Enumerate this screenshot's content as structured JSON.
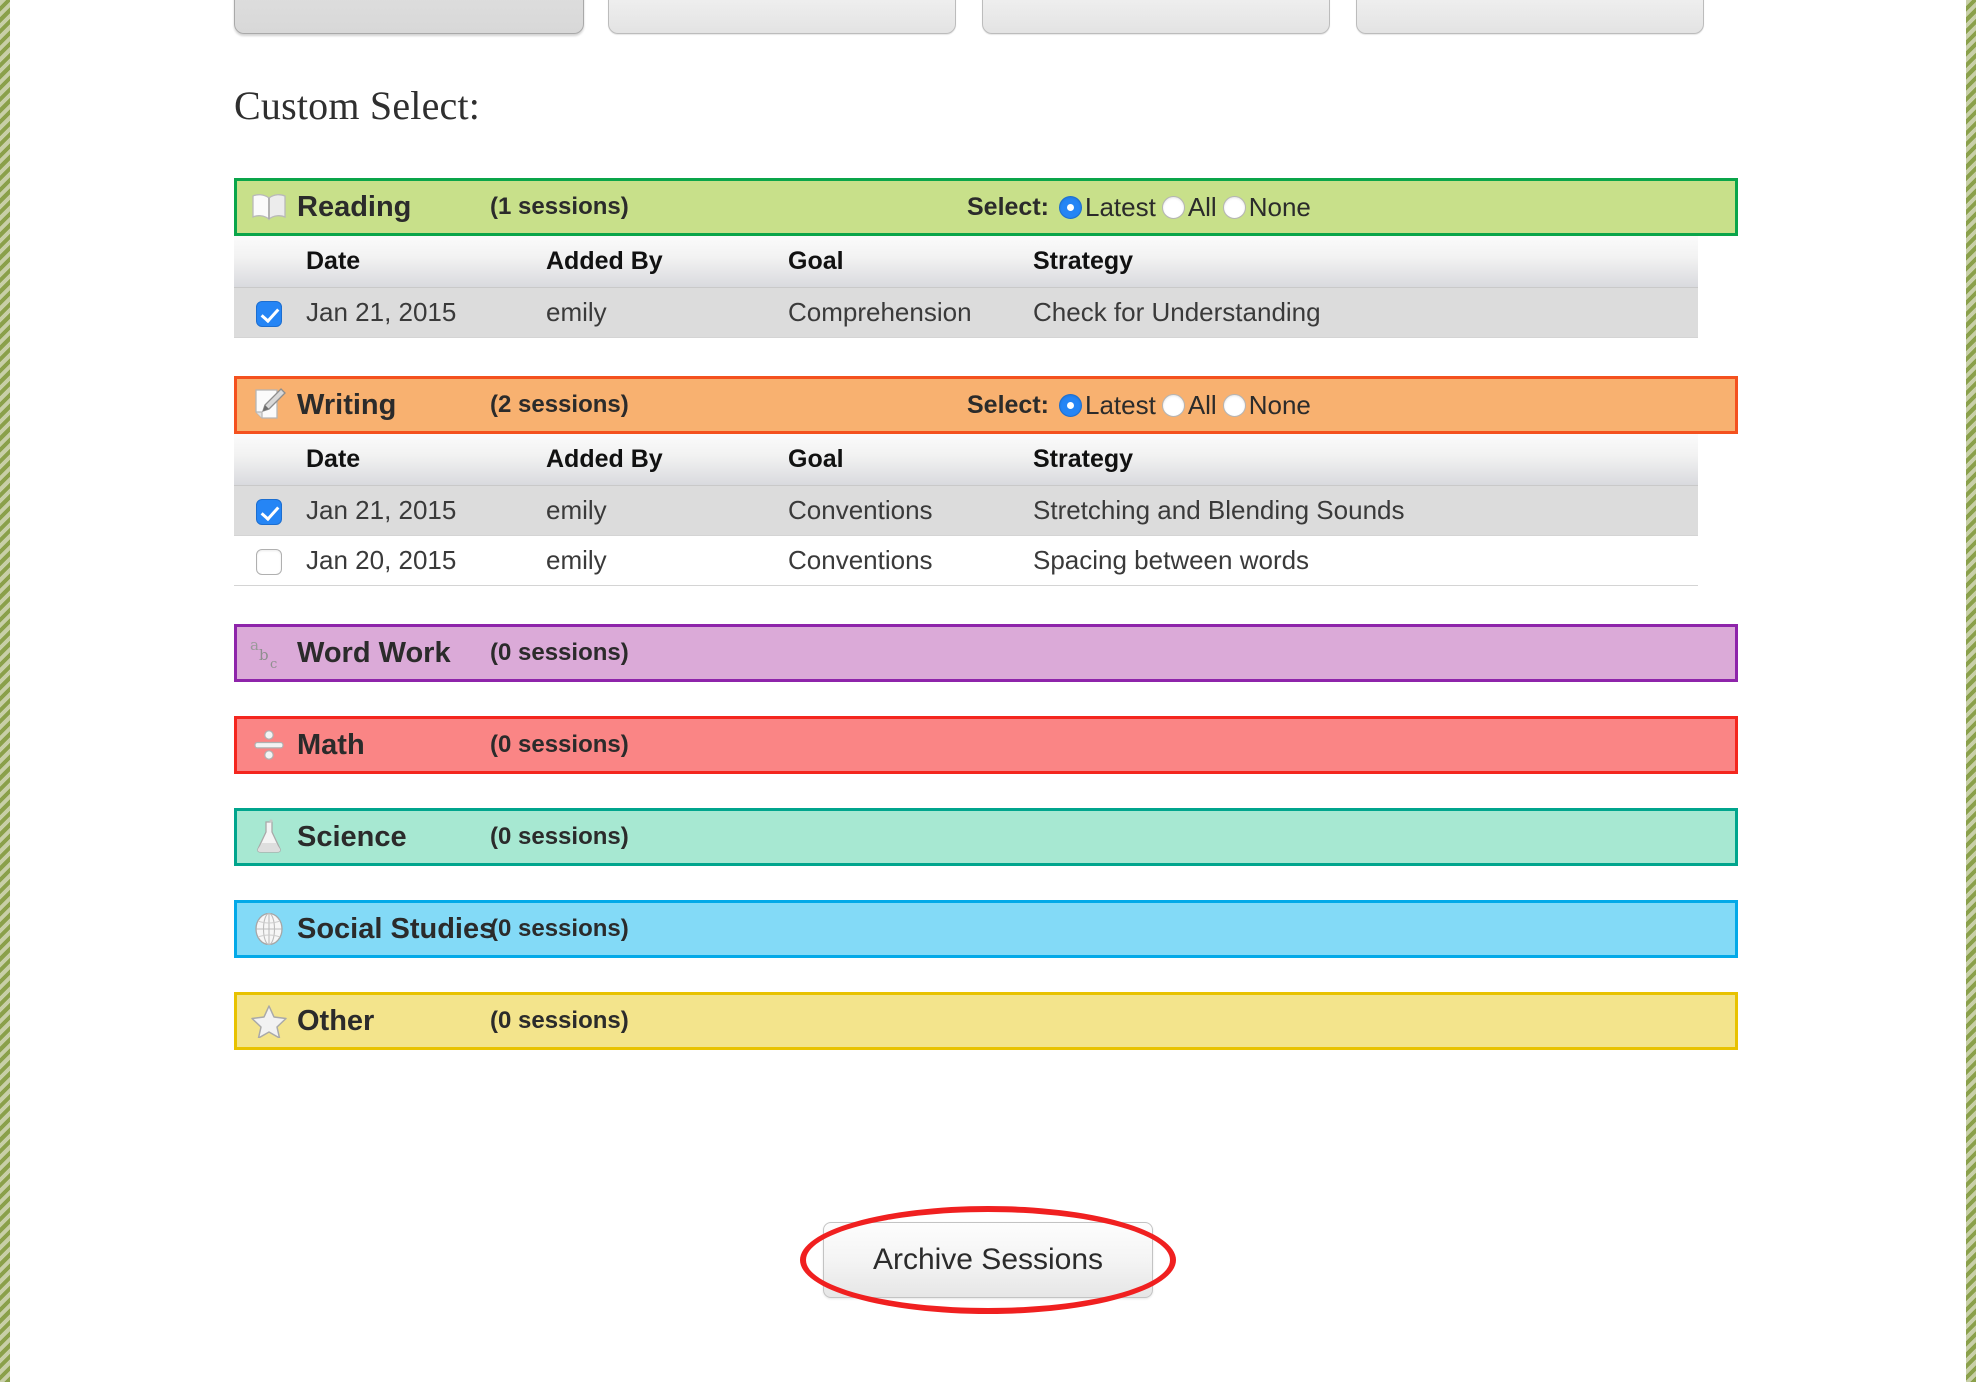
{
  "page": {
    "heading": "Custom Select:",
    "accent_border_color": "#8aa04a"
  },
  "top_tabs": [
    {
      "name": "tab-1",
      "label": "",
      "active": true
    },
    {
      "name": "tab-2",
      "label": "",
      "active": false
    },
    {
      "name": "tab-3",
      "label": "",
      "active": false
    },
    {
      "name": "tab-4",
      "label": "",
      "active": false
    }
  ],
  "select_controls": {
    "label": "Select:",
    "options": [
      "Latest",
      "All",
      "None"
    ],
    "selected": "Latest"
  },
  "table_columns": [
    "Date",
    "Added By",
    "Goal",
    "Strategy"
  ],
  "sections": [
    {
      "id": "reading",
      "name": "Reading",
      "icon": "open-book-icon",
      "count_label": "(1 sessions)",
      "sessions": 1,
      "bg_color": "#c8e08a",
      "border_color": "#0aa54a",
      "expanded": true,
      "select_label": "Select:",
      "select_options": [
        "Latest",
        "All",
        "None"
      ],
      "select_selected": "Latest",
      "rows": [
        {
          "checked": true,
          "date": "Jan 21, 2015",
          "added_by": "emily",
          "goal": "Comprehension",
          "strategy": "Check for Understanding"
        }
      ]
    },
    {
      "id": "writing",
      "name": "Writing",
      "icon": "memo-pencil-icon",
      "count_label": "(2 sessions)",
      "sessions": 2,
      "bg_color": "#f8b170",
      "border_color": "#f4511e",
      "expanded": true,
      "select_label": "Select:",
      "select_options": [
        "Latest",
        "All",
        "None"
      ],
      "select_selected": "Latest",
      "rows": [
        {
          "checked": true,
          "date": "Jan 21, 2015",
          "added_by": "emily",
          "goal": "Conventions",
          "strategy": "Stretching and Blending Sounds"
        },
        {
          "checked": false,
          "date": "Jan 20, 2015",
          "added_by": "emily",
          "goal": "Conventions",
          "strategy": "Spacing between words"
        }
      ]
    },
    {
      "id": "word-work",
      "name": "Word Work",
      "icon": "abc-icon",
      "count_label": "(0 sessions)",
      "sessions": 0,
      "bg_color": "#dbaad8",
      "border_color": "#8e24aa",
      "expanded": false,
      "rows": []
    },
    {
      "id": "math",
      "name": "Math",
      "icon": "division-sign-icon",
      "count_label": "(0 sessions)",
      "sessions": 0,
      "bg_color": "#fa8585",
      "border_color": "#f4261e",
      "expanded": false,
      "rows": []
    },
    {
      "id": "science",
      "name": "Science",
      "icon": "flask-icon",
      "count_label": "(0 sessions)",
      "sessions": 0,
      "bg_color": "#a7e8d2",
      "border_color": "#00a58d",
      "expanded": false,
      "rows": []
    },
    {
      "id": "social-studies",
      "name": "Social Studies",
      "icon": "globe-icon",
      "count_label": "(0 sessions)",
      "sessions": 0,
      "bg_color": "#83daf7",
      "border_color": "#03a9e8",
      "expanded": false,
      "rows": []
    },
    {
      "id": "other",
      "name": "Other",
      "icon": "star-icon",
      "count_label": "(0 sessions)",
      "sessions": 0,
      "bg_color": "#f3e48c",
      "border_color": "#e8c200",
      "expanded": false,
      "rows": []
    }
  ],
  "archive": {
    "button_label": "Archive Sessions",
    "highlight_color": "#f02020"
  }
}
